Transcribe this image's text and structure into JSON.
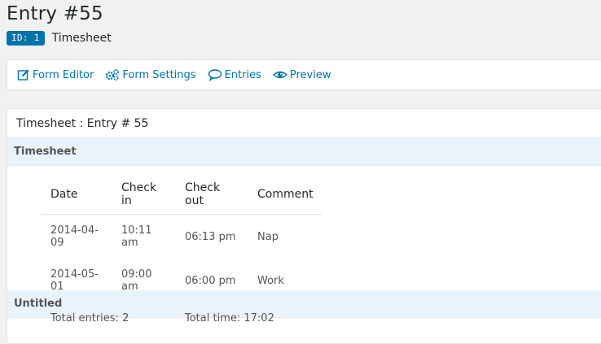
{
  "header": {
    "title": "Entry #55",
    "id_badge": "ID: 1",
    "form_name": "Timesheet"
  },
  "toolbar": {
    "items": [
      {
        "label": "Form Editor",
        "icon": "edit-icon"
      },
      {
        "label": "Form Settings",
        "icon": "gears-icon"
      },
      {
        "label": "Entries",
        "icon": "speech-bubble-icon"
      },
      {
        "label": "Preview",
        "icon": "eye-icon"
      }
    ]
  },
  "panel": {
    "heading": "Timesheet : Entry # 55",
    "sections": [
      {
        "title": "Timesheet",
        "columns": [
          "Date",
          "Check in",
          "Check out",
          "Comment"
        ],
        "rows": [
          [
            "2014-04-09",
            "10:11 am",
            "06:13 pm",
            "Nap"
          ],
          [
            "2014-05-01",
            "09:00 am",
            "06:00 pm",
            "Work"
          ]
        ],
        "total_entries": "Total entries: 2",
        "total_time": "Total time: 17:02"
      },
      {
        "title": "Untitled"
      }
    ]
  },
  "colors": {
    "link": "#0073aa",
    "badge": "#0073aa",
    "section_bar": "#eaf2fa"
  }
}
